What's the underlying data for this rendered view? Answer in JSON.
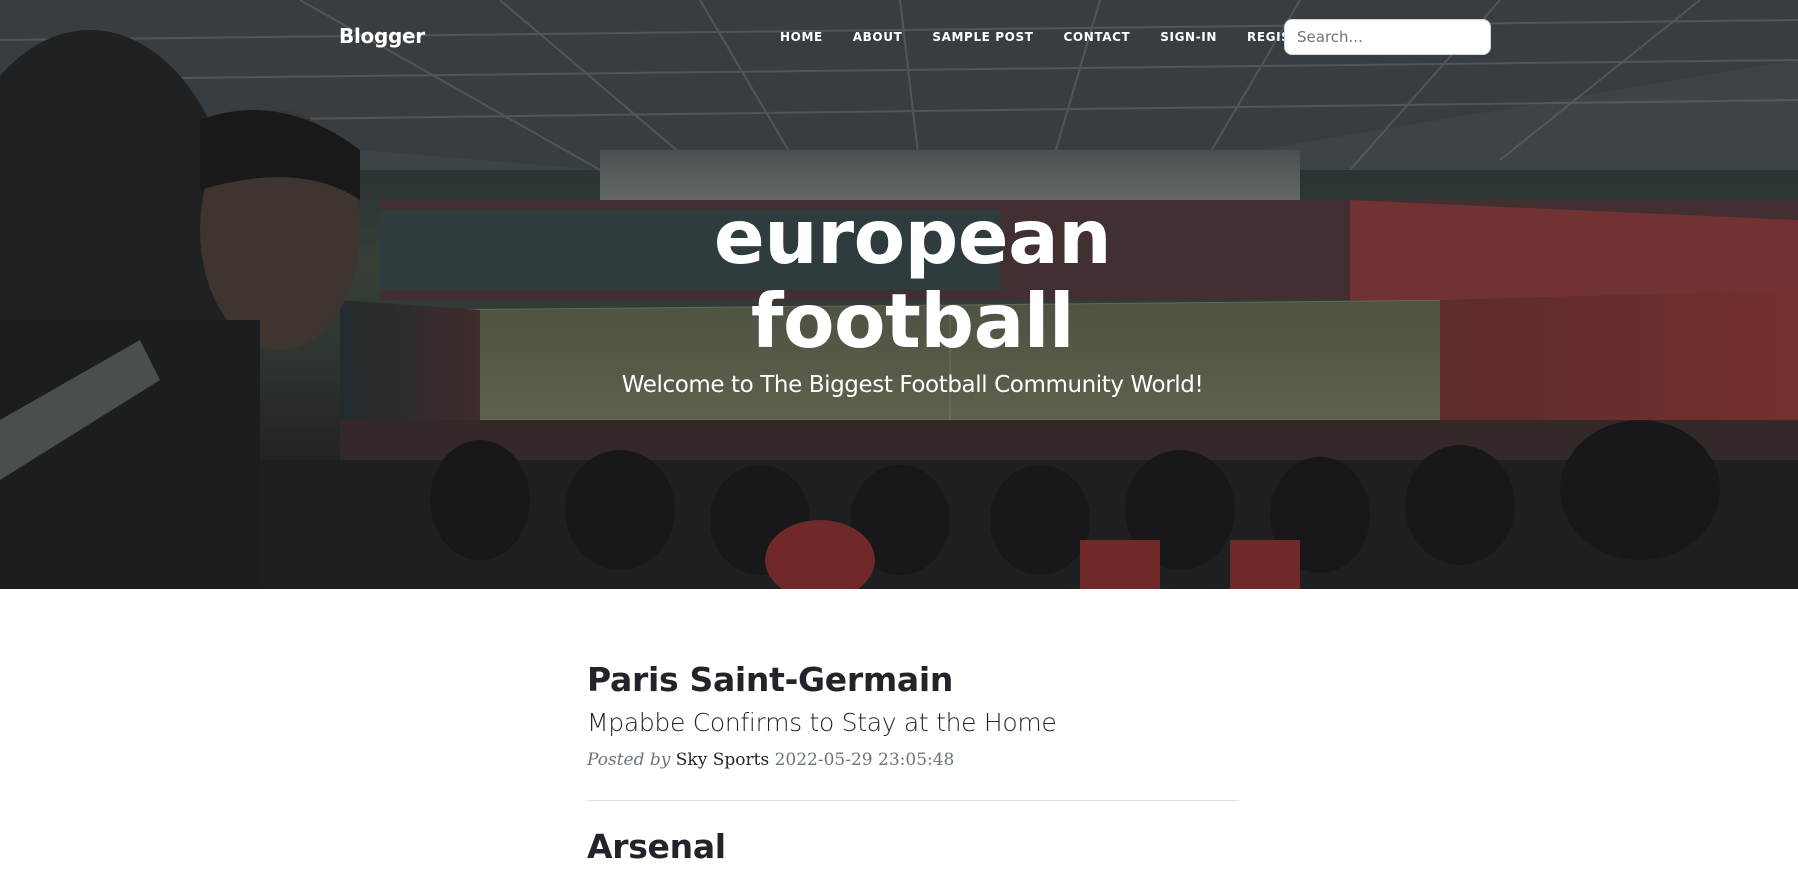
{
  "nav": {
    "brand": "Blogger",
    "links": [
      {
        "label": "HOME"
      },
      {
        "label": "ABOUT"
      },
      {
        "label": "SAMPLE POST"
      },
      {
        "label": "CONTACT"
      },
      {
        "label": "SIGN-IN"
      },
      {
        "label": "REGISTER"
      }
    ],
    "search_placeholder": "Search..."
  },
  "hero": {
    "heading_line1": "european",
    "heading_line2": "football",
    "subheading": "Welcome to The Biggest Football Community World!"
  },
  "posts": [
    {
      "title": "Paris Saint-Germain",
      "subtitle": "Mpabbe Confirms to Stay at the Home",
      "meta_prefix": "Posted by",
      "author": "Sky Sports",
      "date": "2022-05-29 23:05:48"
    },
    {
      "title": "Arsenal"
    }
  ]
}
